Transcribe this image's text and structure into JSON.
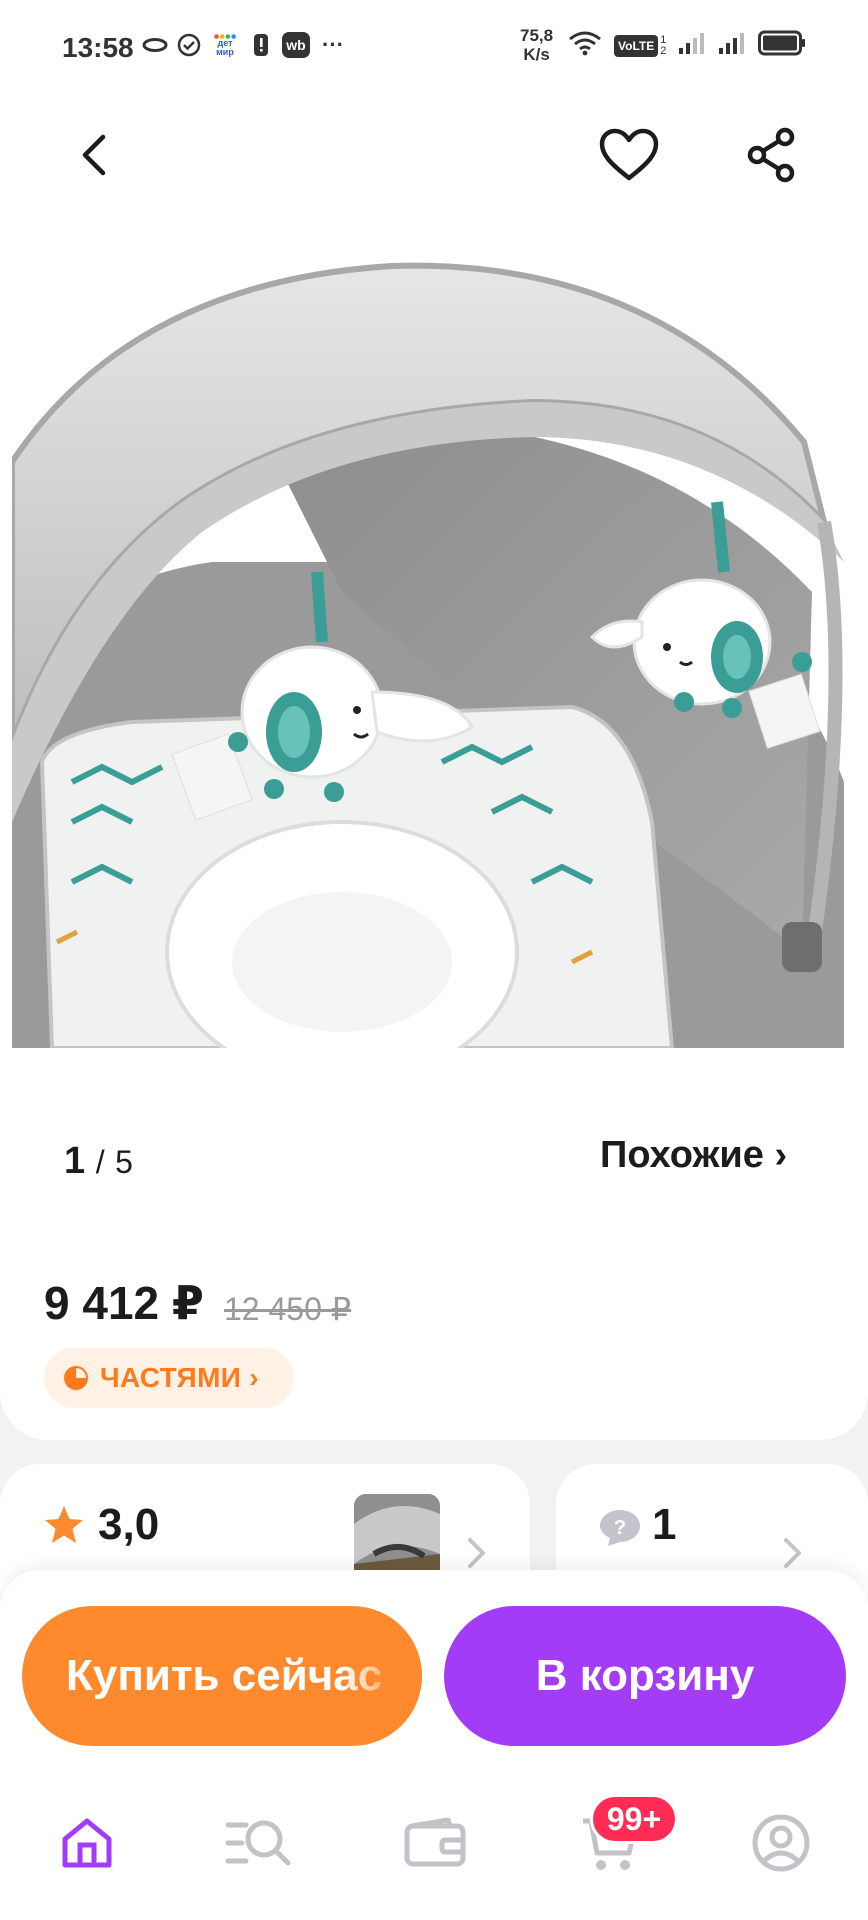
{
  "status_bar": {
    "time": "13:58",
    "speed_value": "75,8",
    "speed_unit": "K/s",
    "volte": "VoLTE",
    "detmir_logo": "дет мир",
    "wb_logo": "wb",
    "more": "···"
  },
  "header": {
    "back_icon": "chevron-left-icon",
    "favorite_icon": "heart-icon",
    "share_icon": "share-icon"
  },
  "gallery": {
    "current": "1",
    "separator": "/",
    "total": "5",
    "similar_label": "Похожие ›"
  },
  "pricing": {
    "price": "9 412 ₽",
    "old_price": "12 450 ₽",
    "installments_label": "ЧАСТЯМИ ›"
  },
  "info": {
    "rating": "3,0",
    "questions_count": "1"
  },
  "actions": {
    "buy_now": "Купить сейчас",
    "add_to_cart": "В корзину"
  },
  "bottom_nav": {
    "cart_badge": "99+",
    "tabs": [
      "home-icon",
      "catalog-search-icon",
      "wallet-icon",
      "cart-icon",
      "profile-icon"
    ]
  },
  "colors": {
    "accent_orange": "#ff8a2e",
    "accent_purple": "#a33cf7",
    "badge_red": "#ff2d55",
    "active_tab": "#a33cf7"
  }
}
